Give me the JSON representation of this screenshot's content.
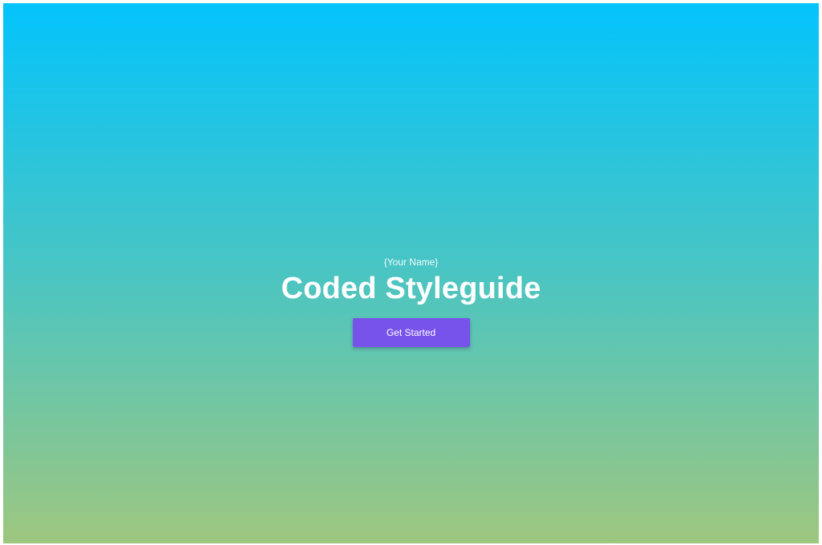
{
  "hero": {
    "eyebrow": "{Your Name}",
    "title": "Coded Styleguide",
    "cta_label": "Get Started"
  },
  "colors": {
    "gradient_top": "#03c4fc",
    "gradient_bottom": "#9ec77f",
    "button": "#7752eb",
    "text": "#ffffff"
  }
}
